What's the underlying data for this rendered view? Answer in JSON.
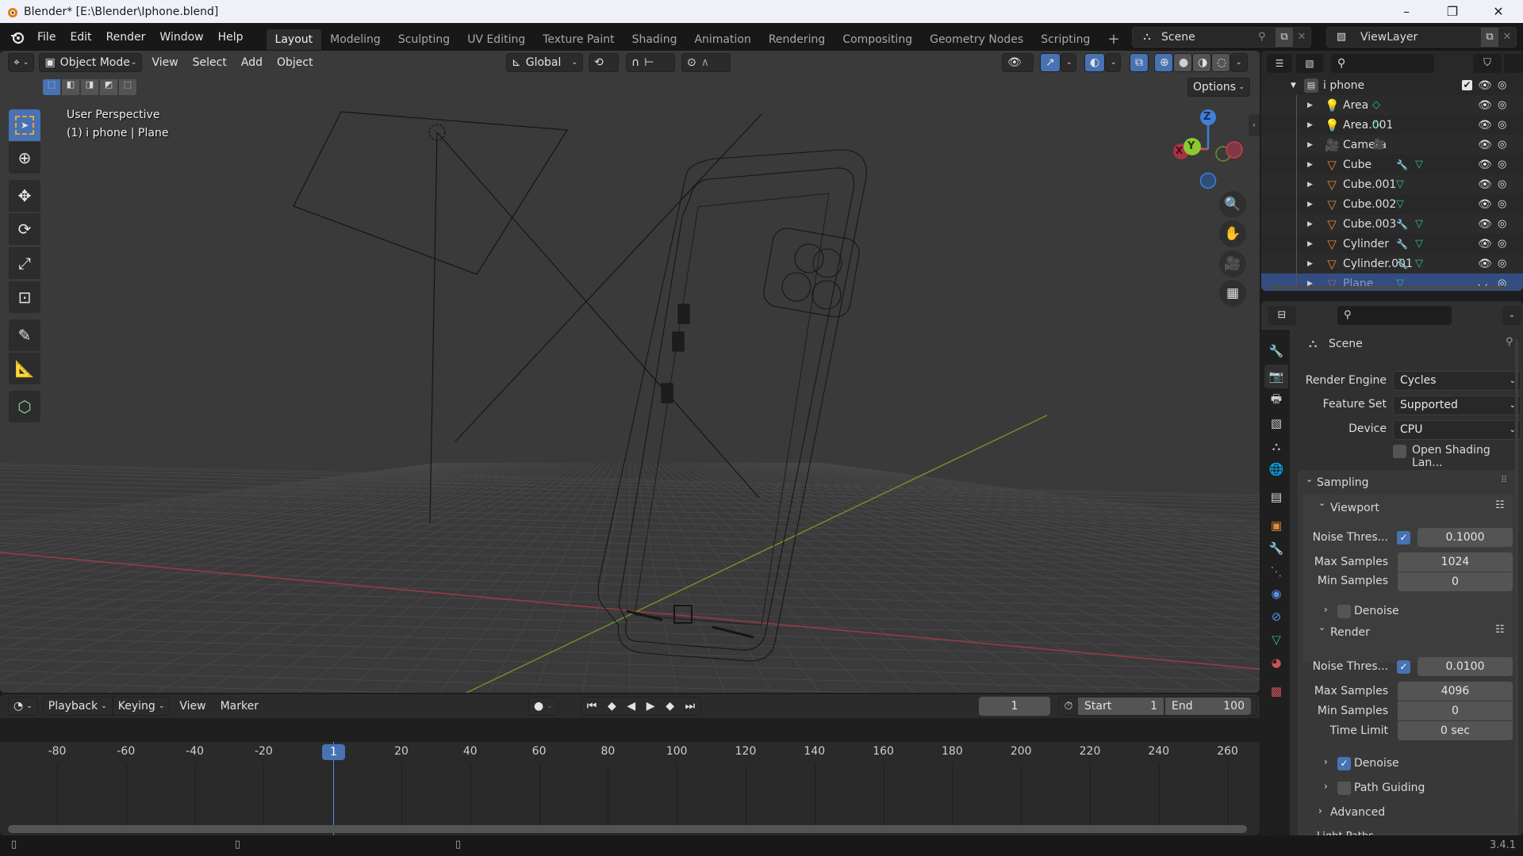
{
  "window": {
    "title": "Blender* [E:\\Blender\\Iphone.blend]",
    "controls": {
      "minimize": "–",
      "maximize": "❐",
      "close": "✕"
    }
  },
  "menu": [
    "File",
    "Edit",
    "Render",
    "Window",
    "Help"
  ],
  "workspaces": {
    "tabs": [
      "Layout",
      "Modeling",
      "Sculpting",
      "UV Editing",
      "Texture Paint",
      "Shading",
      "Animation",
      "Rendering",
      "Compositing",
      "Geometry Nodes",
      "Scripting"
    ],
    "active": "Layout",
    "add": "+"
  },
  "scene_selector": {
    "value": "Scene"
  },
  "viewlayer_selector": {
    "value": "ViewLayer"
  },
  "viewport": {
    "mode": "Object Mode",
    "menus": [
      "View",
      "Select",
      "Add",
      "Object"
    ],
    "transform_orientation": "Global",
    "options_label": "Options",
    "overlay_line1": "User Perspective",
    "overlay_line2": "(1) i phone | Plane",
    "gizmo": {
      "z": "Z",
      "y": "Y",
      "x": "X"
    },
    "shading_active": "wireframe"
  },
  "toolbar": [
    "select-box",
    "cursor",
    "move",
    "rotate",
    "scale",
    "transform",
    "annotate",
    "measure",
    "add-cube"
  ],
  "outliner": {
    "collection": "i phone",
    "items": [
      {
        "name": "Area",
        "type": "light"
      },
      {
        "name": "Area.001",
        "type": "light"
      },
      {
        "name": "Camera",
        "type": "camera"
      },
      {
        "name": "Cube",
        "type": "mesh",
        "modifier": true
      },
      {
        "name": "Cube.001",
        "type": "mesh",
        "modifier": false
      },
      {
        "name": "Cube.002",
        "type": "mesh",
        "modifier": false
      },
      {
        "name": "Cube.003",
        "type": "mesh",
        "modifier": true
      },
      {
        "name": "Cylinder",
        "type": "mesh",
        "modifier": true
      },
      {
        "name": "Cylinder.001",
        "type": "mesh",
        "modifier": true
      },
      {
        "name": "Plane",
        "type": "mesh",
        "modifier": false,
        "selected": true,
        "hidden": true
      }
    ]
  },
  "properties": {
    "context": "Scene",
    "render_engine_label": "Render Engine",
    "render_engine": "Cycles",
    "feature_set_label": "Feature Set",
    "feature_set": "Supported",
    "device_label": "Device",
    "device": "CPU",
    "osl_label": "Open Shading Lan...",
    "osl_checked": false,
    "sampling": {
      "title": "Sampling",
      "viewport": {
        "title": "Viewport",
        "noise_label": "Noise Thres...",
        "noise_enabled": true,
        "noise_value": "0.1000",
        "max_label": "Max Samples",
        "max_value": "1024",
        "min_label": "Min Samples",
        "min_value": "0",
        "denoise_label": "Denoise",
        "denoise_checked": false
      },
      "render": {
        "title": "Render",
        "noise_label": "Noise Thres...",
        "noise_enabled": true,
        "noise_value": "0.0100",
        "max_label": "Max Samples",
        "max_value": "4096",
        "min_label": "Min Samples",
        "min_value": "0",
        "time_label": "Time Limit",
        "time_value": "0 sec",
        "denoise_label": "Denoise",
        "denoise_checked": true,
        "path_guiding_label": "Path Guiding",
        "path_guiding_checked": false,
        "advanced_label": "Advanced"
      },
      "light_paths_label": "Light Paths"
    }
  },
  "timeline": {
    "menus": [
      "Playback",
      "Keying",
      "View",
      "Marker"
    ],
    "current_frame": "1",
    "start_label": "Start",
    "start": "1",
    "end_label": "End",
    "end": "100",
    "ticks": [
      "-80",
      "-60",
      "-40",
      "-20",
      "1",
      "20",
      "40",
      "60",
      "80",
      "100",
      "120",
      "140",
      "160",
      "180",
      "200",
      "220",
      "240",
      "260"
    ]
  },
  "status": {
    "version": "3.4.1"
  }
}
